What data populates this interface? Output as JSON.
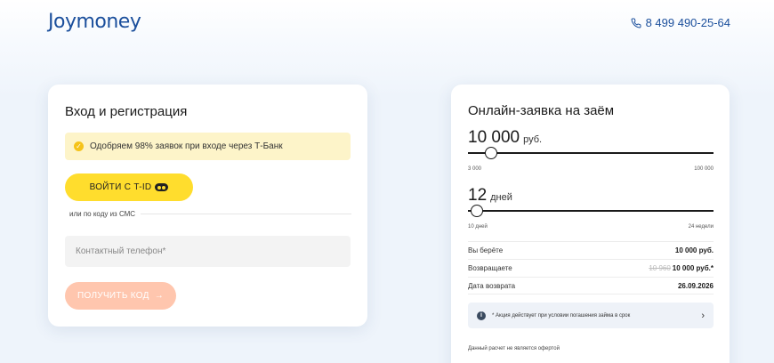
{
  "header": {
    "logo": "Joymoney",
    "phone": "8 499 490-25-64"
  },
  "login": {
    "title": "Вход и регистрация",
    "promo": "Одобряем 98% заявок при входе через Т-Банк",
    "tid_button": "ВОЙТИ С T-ID",
    "or_sms": "или по коду из СМС",
    "phone_placeholder": "Контактный телефон*",
    "get_code_button": "ПОЛУЧИТЬ КОД",
    "get_code_arrow": "→"
  },
  "loan": {
    "title": "Онлайн-заявка на заём",
    "amount": {
      "value": "10 000",
      "unit": "руб.",
      "min": "3 000",
      "max": "100 000",
      "level": 0.072
    },
    "term": {
      "value": "12",
      "unit": "дней",
      "min": "10 дней",
      "max": "24 недели",
      "level": 0.012
    },
    "summary": {
      "take_label": "Вы берёте",
      "take_value": "10 000 руб.",
      "return_label": "Возвращаете",
      "return_old": "10 960",
      "return_value": "10 000 руб.*",
      "date_label": "Дата возврата",
      "date_value": "26.09.2026"
    },
    "notice": "* Акция действует при условии погашения займа в срок",
    "disclaimer": "Данный расчет не является офертой"
  },
  "colors": {
    "brand": "#1b4f9c",
    "tid_yellow": "#ffdd2d",
    "code_button": "#ffc6ae",
    "promo_bg": "#fdf4c9"
  }
}
